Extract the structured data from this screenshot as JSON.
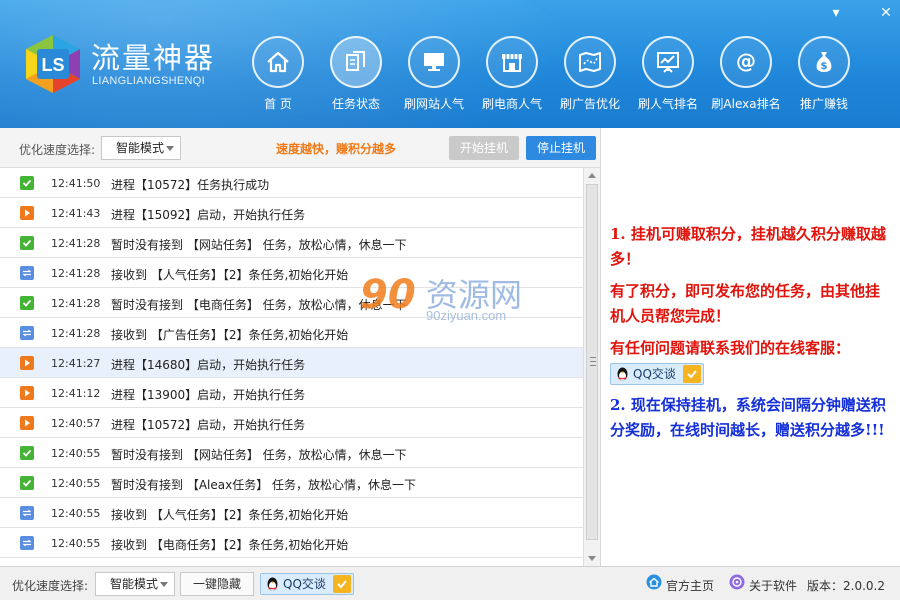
{
  "window": {
    "min_label": "▾",
    "close_label": "✕"
  },
  "brand": {
    "name_cn": "流量神器",
    "name_en": "LIANGLIANGSHENQI",
    "logo_text": "LS"
  },
  "nav": [
    {
      "label": "首 页",
      "icon": "home-icon",
      "active": false
    },
    {
      "label": "任务状态",
      "icon": "task-icon",
      "active": true
    },
    {
      "label": "刷网站人气",
      "icon": "monitor-icon",
      "active": false
    },
    {
      "label": "刷电商人气",
      "icon": "shop-icon",
      "active": false
    },
    {
      "label": "刷广告优化",
      "icon": "map-icon",
      "active": false
    },
    {
      "label": "刷人气排名",
      "icon": "chart-board-icon",
      "active": false
    },
    {
      "label": "刷Alexa排名",
      "icon": "at-icon",
      "active": false
    },
    {
      "label": "推广赚钱",
      "icon": "money-bag-icon",
      "active": false
    }
  ],
  "toolbar": {
    "speed_label": "优化速度选择:",
    "speed_value": "智能模式",
    "slogan": "速度越快，赚积分越多",
    "start_label": "开始挂机",
    "stop_label": "停止挂机"
  },
  "logs": [
    {
      "type": "ok",
      "time": "12:41:50",
      "msg": "进程【10572】任务执行成功"
    },
    {
      "type": "start",
      "time": "12:41:43",
      "msg": "进程【15092】启动，开始执行任务"
    },
    {
      "type": "ok",
      "time": "12:41:28",
      "msg": "暂时没有接到 【网站任务】 任务，放松心情，休息一下"
    },
    {
      "type": "recv",
      "time": "12:41:28",
      "msg": "接收到 【人气任务】【2】条任务,初始化开始"
    },
    {
      "type": "ok",
      "time": "12:41:28",
      "msg": "暂时没有接到 【电商任务】 任务，放松心情，休息一下"
    },
    {
      "type": "recv",
      "time": "12:41:28",
      "msg": "接收到 【广告任务】【2】条任务,初始化开始"
    },
    {
      "type": "start",
      "time": "12:41:27",
      "msg": "进程【14680】启动，开始执行任务",
      "highlight": true
    },
    {
      "type": "start",
      "time": "12:41:12",
      "msg": "进程【13900】启动，开始执行任务"
    },
    {
      "type": "start",
      "time": "12:40:57",
      "msg": "进程【10572】启动，开始执行任务"
    },
    {
      "type": "ok",
      "time": "12:40:55",
      "msg": "暂时没有接到 【网站任务】 任务，放松心情，休息一下"
    },
    {
      "type": "ok",
      "time": "12:40:55",
      "msg": "暂时没有接到 【Aleax任务】 任务，放松心情，休息一下"
    },
    {
      "type": "recv",
      "time": "12:40:55",
      "msg": "接收到 【人气任务】【2】条任务,初始化开始"
    },
    {
      "type": "recv",
      "time": "12:40:55",
      "msg": "接收到 【电商任务】【2】条任务,初始化开始"
    },
    {
      "type": "recv",
      "time": "",
      "msg": ""
    }
  ],
  "info": {
    "p1": "1. 挂机可赚取积分，挂机越久积分赚取越多！",
    "p2": "有了积分，即可发布您的任务，由其他挂机人员帮您完成！",
    "p3": "有任何问题请联系我们的在线客服：",
    "p4": "2. 现在保持挂机，系统会间隔分钟赠送积分奖励，在线时间越长，赠送积分越多!!!",
    "qq_label": "QQ交谈"
  },
  "watermark": {
    "num": "90",
    "cn": "资源网",
    "url": "90ziyuan.com"
  },
  "bottom": {
    "speed_label": "优化速度选择:",
    "speed_value": "智能模式",
    "hide_label": "一键隐藏",
    "qq_label": "QQ交谈",
    "home_label": "官方主页",
    "about_label": "关于软件",
    "version": "版本：2.0.0.2"
  },
  "colors": {
    "header": "#2b8fe0",
    "ok": "#45b336",
    "start": "#ef7a1e",
    "recv": "#5a8ee0",
    "red_text": "#e0140c",
    "blue_text": "#1530d8",
    "slogan": "#f07a18"
  }
}
